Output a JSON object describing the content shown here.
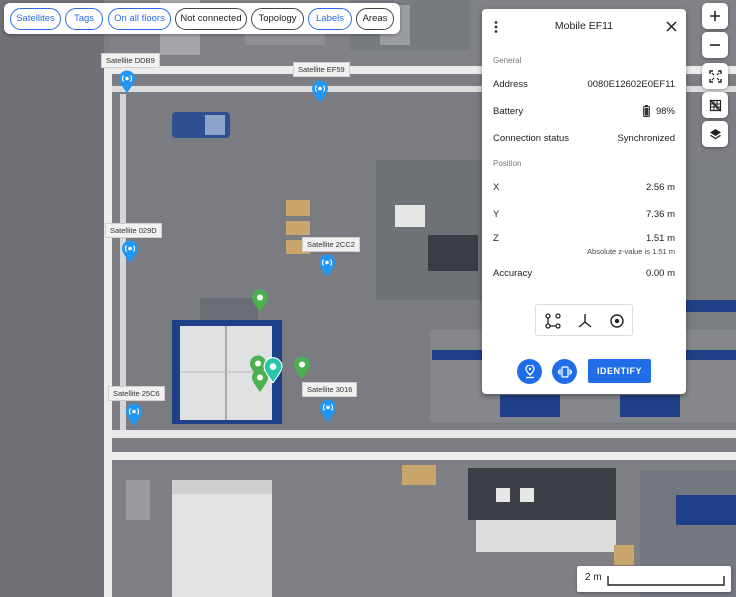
{
  "filter_chips": [
    {
      "label": "Satellites",
      "active": true
    },
    {
      "label": "Tags",
      "active": true
    },
    {
      "label": "On all floors",
      "active": true
    },
    {
      "label": "Not connected",
      "active": false
    },
    {
      "label": "Topology",
      "active": false
    },
    {
      "label": "Labels",
      "active": true
    },
    {
      "label": "Areas",
      "active": false
    }
  ],
  "map_controls": [
    "zoom-in-icon",
    "zoom-out-icon",
    "fit-screen-icon",
    "grid-off-icon",
    "layers-icon"
  ],
  "satellites": [
    "Satellite DDB9",
    "Satellite EF59",
    "Satellite 029D",
    "Satellite 2CC2",
    "Satellite 25C6",
    "Satellite 3016"
  ],
  "panel": {
    "title": "Mobile EF11",
    "general_label": "General",
    "address_label": "Address",
    "address": "0080E12602E0EF11",
    "battery_label": "Battery",
    "battery": "98%",
    "connection_label": "Connection status",
    "connection": "Synchronized",
    "position_label": "Position",
    "x_label": "X",
    "x": "2.56 m",
    "y_label": "Y",
    "y": "7.36 m",
    "z_label": "Z",
    "z": "1.51 m",
    "z_note": "Absolute z-value is 1.51 m",
    "accuracy_label": "Accuracy",
    "accuracy": "0.00 m",
    "identify_label": "IDENTIFY"
  },
  "scale_label": "2 m",
  "colors": {
    "accent": "#1f6ee8",
    "tag_pin": "#4caf50",
    "selected_pin": "#26c6a6",
    "satellite_pin": "#2196f3"
  }
}
